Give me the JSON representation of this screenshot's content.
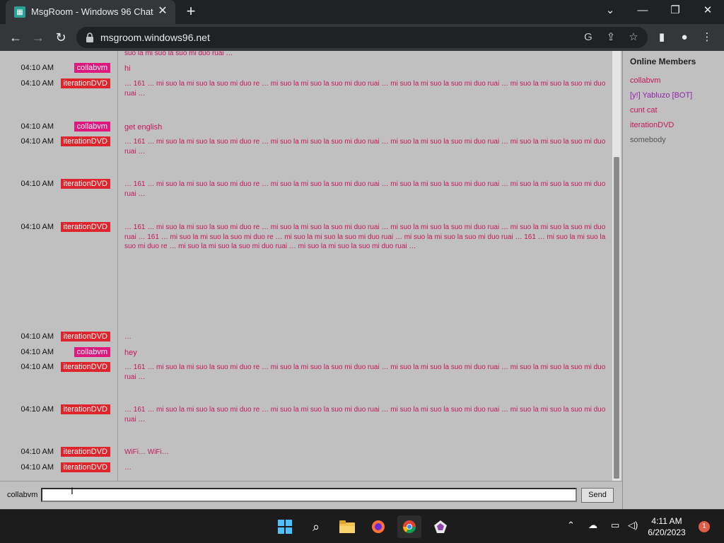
{
  "browser": {
    "tab_title": "MsgRoom - Windows 96 Chat",
    "url": "msgroom.windows96.net"
  },
  "colors": {
    "nick_pink": "#e0187e",
    "nick_red": "#e0242c",
    "text_pink": "#c2185b"
  },
  "chat": {
    "top_fragment": "suo la mi suo la suo mi duo ruai …",
    "messages": [
      {
        "time": "04:10 AM",
        "nick": "collabvm",
        "nick_color": "#e0187e",
        "text": "hi",
        "big": true
      },
      {
        "time": "04:10 AM",
        "nick": "iterationDVD",
        "nick_color": "#e0242c",
        "text": "… 161 … mi suo la mi suo la suo mi duo re … mi suo la mi suo la suo mi duo ruai … mi suo la mi suo la suo mi duo ruai … mi suo la mi suo la suo mi duo ruai …",
        "big": false
      },
      {
        "time": "04:10 AM",
        "nick": "collabvm",
        "nick_color": "#e0187e",
        "text": "get english",
        "big": true
      },
      {
        "time": "04:10 AM",
        "nick": "iterationDVD",
        "nick_color": "#e0242c",
        "text": "… 161 … mi suo la mi suo la suo mi duo re … mi suo la mi suo la suo mi duo ruai … mi suo la mi suo la suo mi duo ruai … mi suo la mi suo la suo mi duo ruai …",
        "big": false
      },
      {
        "time": "04:10 AM",
        "nick": "iterationDVD",
        "nick_color": "#e0242c",
        "text": "… 161 … mi suo la mi suo la suo mi duo re … mi suo la mi suo la suo mi duo ruai … mi suo la mi suo la suo mi duo ruai … mi suo la mi suo la suo mi duo ruai …",
        "big": false
      },
      {
        "time": "04:10 AM",
        "nick": "iterationDVD",
        "nick_color": "#e0242c",
        "text": "… 161 … mi suo la mi suo la suo mi duo re … mi suo la mi suo la suo mi duo ruai … mi suo la mi suo la suo mi duo ruai … mi suo la mi suo la suo mi duo ruai … 161 … mi suo la mi suo la suo mi duo re … mi suo la mi suo la suo mi duo ruai … mi suo la mi suo la suo mi duo ruai … 161 … mi suo la mi suo la suo mi duo re … mi suo la mi suo la suo mi duo ruai … mi suo la mi suo la suo mi duo ruai …",
        "big": false
      },
      {
        "time": "04:10 AM",
        "nick": "iterationDVD",
        "nick_color": "#e0242c",
        "text": "…",
        "big": false
      },
      {
        "time": "04:10 AM",
        "nick": "collabvm",
        "nick_color": "#e0187e",
        "text": "hey",
        "big": true
      },
      {
        "time": "04:10 AM",
        "nick": "iterationDVD",
        "nick_color": "#e0242c",
        "text": "… 161 … mi suo la mi suo la suo mi duo re … mi suo la mi suo la suo mi duo ruai … mi suo la mi suo la suo mi duo ruai … mi suo la mi suo la suo mi duo ruai …",
        "big": false
      },
      {
        "time": "04:10 AM",
        "nick": "iterationDVD",
        "nick_color": "#e0242c",
        "text": "… 161 … mi suo la mi suo la suo mi duo re … mi suo la mi suo la suo mi duo ruai … mi suo la mi suo la suo mi duo ruai … mi suo la mi suo la suo mi duo ruai …",
        "big": false
      },
      {
        "time": "04:10 AM",
        "nick": "iterationDVD",
        "nick_color": "#e0242c",
        "text": "WiFi… WiFi…",
        "big": false
      },
      {
        "time": "04:10 AM",
        "nick": "iterationDVD",
        "nick_color": "#e0242c",
        "text": "…",
        "big": false
      }
    ]
  },
  "members": {
    "title": "Online Members",
    "list": [
      {
        "name": "collabvm",
        "color": "#c2185b"
      },
      {
        "name": "[y!] Yabluzo [BOT]",
        "color": "#8e24aa"
      },
      {
        "name": "cunt cat",
        "color": "#c2185b"
      },
      {
        "name": "iterationDVD",
        "color": "#c2185b"
      },
      {
        "name": "somebody",
        "color": "#555555"
      }
    ]
  },
  "composer": {
    "username": "collabvm",
    "input_value": "",
    "send_label": "Send"
  },
  "taskbar": {
    "time": "4:11 AM",
    "date": "6/20/2023",
    "notifications": "1"
  }
}
